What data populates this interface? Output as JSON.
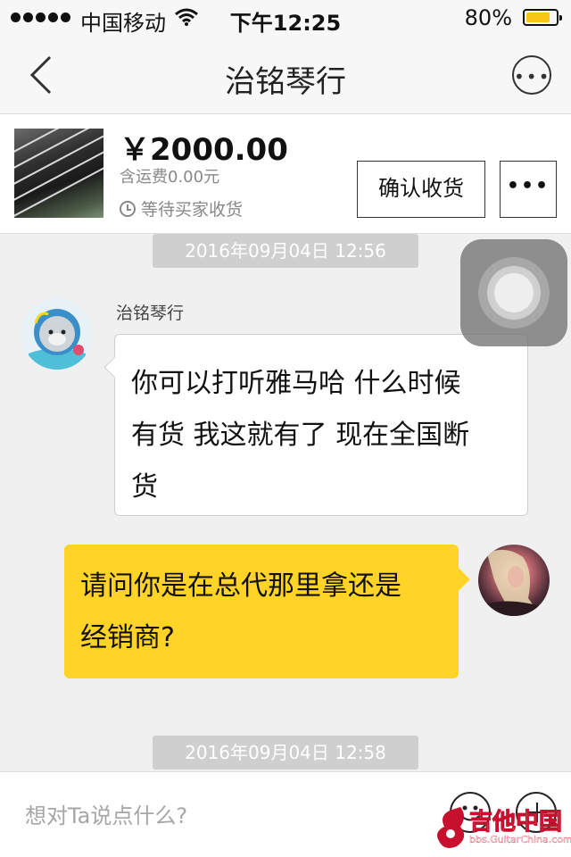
{
  "status_bar": {
    "carrier": "中国移动",
    "time": "下午12:25",
    "battery_text": "80%",
    "battery_level": 0.8
  },
  "nav": {
    "title": "治铭琴行",
    "back_icon": "chevron-left-icon",
    "more_icon": "more-circle-icon"
  },
  "product": {
    "price": "￥2000.00",
    "shipping": "含运费0.00元",
    "status": "等待买家收货",
    "confirm_label": "确认收货",
    "more_label": "•••"
  },
  "chat": {
    "messages": [
      {
        "timestamp": "2016年09月04日 12:56"
      },
      {
        "sender": "治铭琴行",
        "direction": "in",
        "lines": [
          "你可以打听雅马哈 什么时候",
          "有货 我这就有了 现在全国断",
          "货"
        ]
      },
      {
        "direction": "out",
        "lines": [
          "请问你是在总代那里拿还是",
          "经销商?"
        ]
      },
      {
        "timestamp": "2016年09月04日 12:58"
      }
    ]
  },
  "input": {
    "placeholder": "想对Ta说点什么?",
    "emoji_icon": "smiley-icon",
    "plus_icon": "plus-circle-icon"
  },
  "watermark": {
    "title": "吉他中国",
    "url": "bbs.GuitarChina.com"
  },
  "colors": {
    "outgoing_bubble": "#ffd426",
    "battery": "#f5c518",
    "timestamp_bg": "#cfcfcf",
    "watermark_red": "#c8102e"
  }
}
